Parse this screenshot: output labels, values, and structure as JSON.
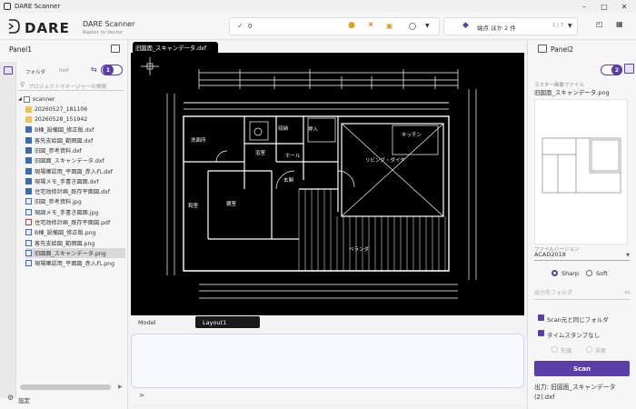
{
  "window": {
    "title": "DARE Scanner"
  },
  "header": {
    "logo": "DARE",
    "app_name": "DARE Scanner",
    "app_subtitle": "Raster to Vector",
    "status_count": "0",
    "points_label": "端点 ほか 2 件",
    "page_indicator": "1 / 7"
  },
  "left_panel": {
    "title": "Panel1",
    "tab_folder": "フォルダ",
    "tab_layer": "Inof",
    "badge": "1",
    "search_placeholder": "プロジェクトマネージャーの検索",
    "root": "scanner",
    "items": [
      {
        "label": "20260527_181106",
        "type": "folder"
      },
      {
        "label": "20260528_151942",
        "type": "folder"
      },
      {
        "label": "B棟_設備図_修正版.dxf",
        "type": "dxf"
      },
      {
        "label": "客先支給図_範囲図.dxf",
        "type": "dxf"
      },
      {
        "label": "旧図_参考資料.dxf",
        "type": "dxf"
      },
      {
        "label": "旧図面_スキャンデータ.dxf",
        "type": "dxf"
      },
      {
        "label": "現場確認用_平面図_赤入れ.dxf",
        "type": "dxf"
      },
      {
        "label": "現場メモ_手書き図面.dxf",
        "type": "dxf"
      },
      {
        "label": "住宅改修計画_既存平面図.dxf",
        "type": "dxf"
      },
      {
        "label": "旧図_参考資料.jpg",
        "type": "jpg"
      },
      {
        "label": "現調メモ_手書き図面.jpg",
        "type": "jpg"
      },
      {
        "label": "住宅改修計画_既存平面図.pdf",
        "type": "pdf"
      },
      {
        "label": "B棟_設備図_修正版.png",
        "type": "png"
      },
      {
        "label": "客先支給図_範囲図.png",
        "type": "png"
      },
      {
        "label": "旧図面_スキャンデータ.png",
        "type": "png"
      },
      {
        "label": "現場確認用_平面図_赤入れ.png",
        "type": "png"
      }
    ],
    "settings_label": "設定"
  },
  "center": {
    "doc_tab": "旧図面_スキャンデータ.dxf",
    "model_tab": "Model",
    "layout_tab": "Layout1",
    "command_prompt": ">"
  },
  "drawing": {
    "rooms": [
      "リビング・ダイタ",
      "浴室",
      "洗面所",
      "玄関",
      "寝室",
      "収納",
      "ホール",
      "キッチン",
      "ベランダ",
      "和室",
      "押入"
    ]
  },
  "right_panel": {
    "title": "Panel2",
    "badge": "2",
    "raster_label": "ラスター画像ファイル",
    "raster_file": "旧図面_スキャンデータ.png",
    "version_label": "ファイルバージョン",
    "version_value": "ACAD2018",
    "mode_sharp": "Sharp",
    "mode_soft": "Soft",
    "output_folder_placeholder": "出力先フォルダ",
    "check_same_folder": "Scan元と同じフォルダ",
    "check_no_timestamp": "タイムスタンプなし",
    "radio_prefix": "先頭",
    "radio_suffix": "末尾",
    "scan_button": "Scan",
    "output_text": "出力: 旧図面_スキャンデータ (2).dxf"
  },
  "colors": {
    "accent": "#5b3fa8",
    "canvas_bg": "#000000",
    "drawing_line": "#ffffff"
  }
}
